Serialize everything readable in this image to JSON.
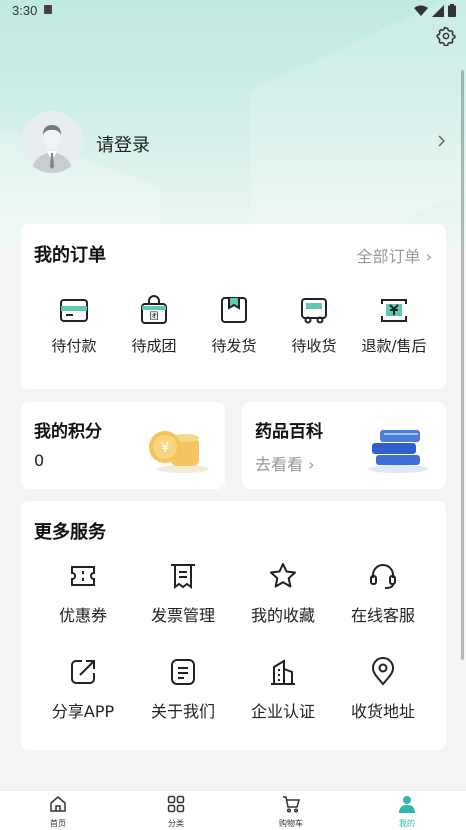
{
  "status_bar": {
    "time": "3:30"
  },
  "profile": {
    "login_text": "请登录"
  },
  "orders": {
    "title": "我的订单",
    "all_label": "全部订单",
    "items": [
      {
        "label": "待付款",
        "icon": "wallet-icon"
      },
      {
        "label": "待成团",
        "icon": "group-bag-icon"
      },
      {
        "label": "待发货",
        "icon": "package-icon"
      },
      {
        "label": "待收货",
        "icon": "truck-icon"
      },
      {
        "label": "退款/售后",
        "icon": "refund-icon"
      }
    ]
  },
  "points": {
    "title": "我的积分",
    "value": "0"
  },
  "wiki": {
    "title": "药品百科",
    "link": "去看看"
  },
  "services": {
    "title": "更多服务",
    "items": [
      {
        "label": "优惠券",
        "icon": "coupon-icon"
      },
      {
        "label": "发票管理",
        "icon": "invoice-icon"
      },
      {
        "label": "我的收藏",
        "icon": "star-icon"
      },
      {
        "label": "在线客服",
        "icon": "headset-icon"
      },
      {
        "label": "分享APP",
        "icon": "share-icon"
      },
      {
        "label": "关于我们",
        "icon": "about-icon"
      },
      {
        "label": "企业认证",
        "icon": "building-icon"
      },
      {
        "label": "收货地址",
        "icon": "location-icon"
      }
    ]
  },
  "tabbar": {
    "items": [
      {
        "label": "首页",
        "icon": "home-icon"
      },
      {
        "label": "分类",
        "icon": "category-icon"
      },
      {
        "label": "购物车",
        "icon": "cart-icon"
      },
      {
        "label": "我的",
        "icon": "user-icon"
      }
    ]
  },
  "colors": {
    "accent": "#2fb8a8",
    "hero_top": "#bfe9e2"
  }
}
